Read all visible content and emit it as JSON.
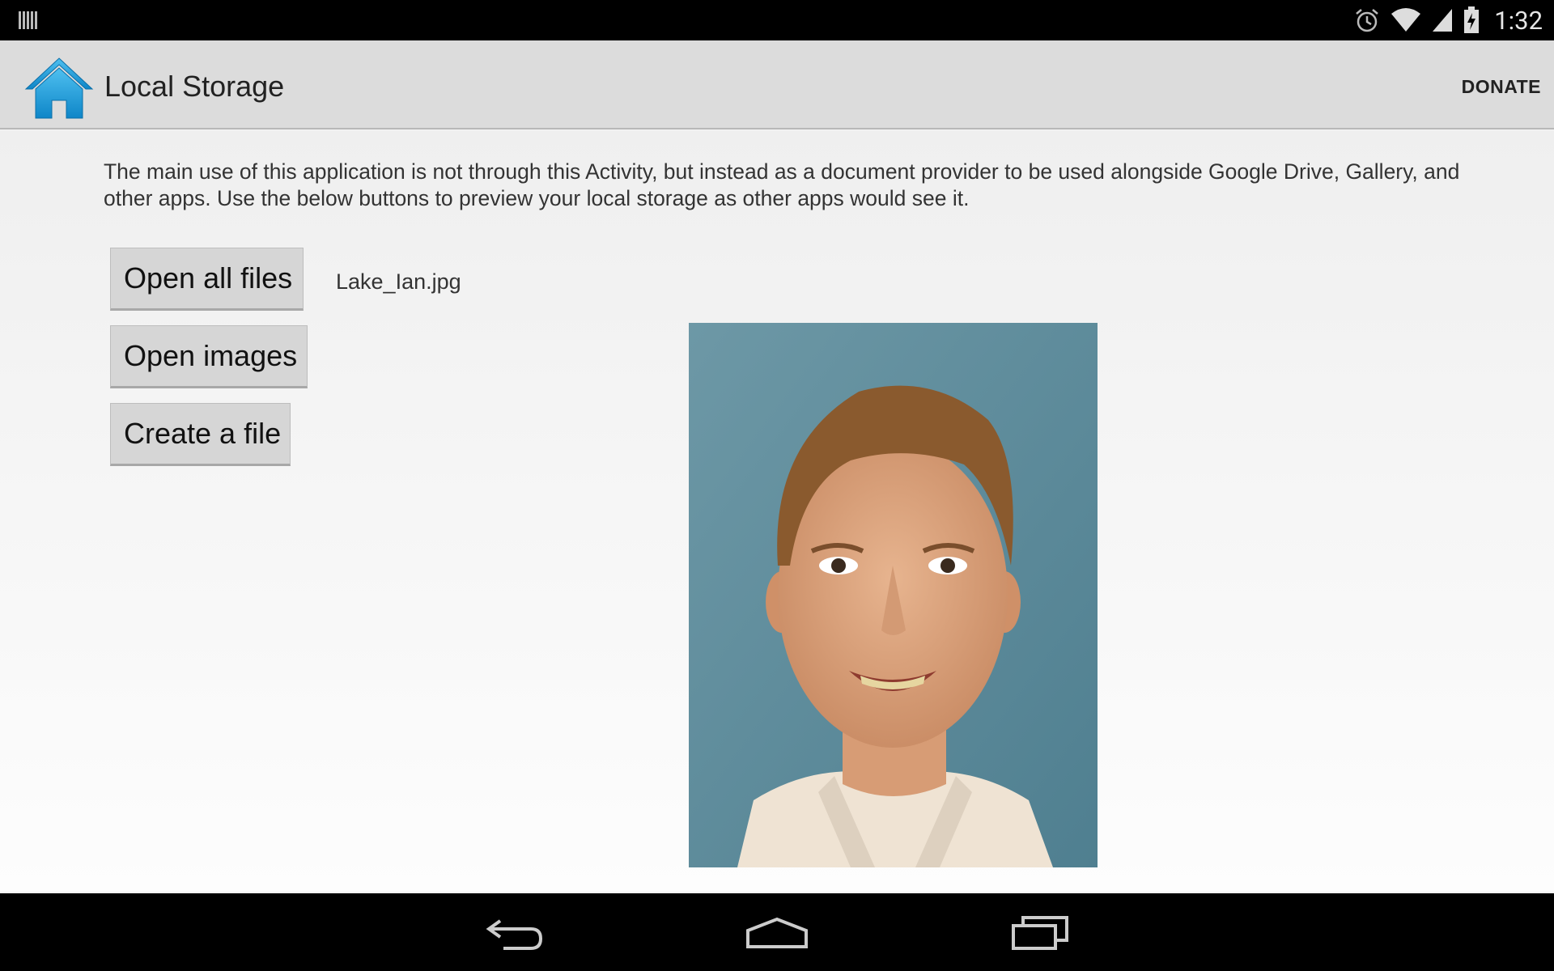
{
  "status_bar": {
    "notification_icon": "barcode-icon",
    "alarm_icon": "alarm-icon",
    "wifi_icon": "wifi-icon",
    "signal_icon": "signal-icon",
    "battery_icon": "battery-charging-icon",
    "time": "1:32"
  },
  "action_bar": {
    "app_icon": "home-icon",
    "title": "Local Storage",
    "donate_label": "DONATE"
  },
  "main": {
    "intro_text": "The main use of this application is not through this Activity, but instead as a document provider to be used alongside Google Drive, Gallery, and other apps. Use the below buttons to preview your local storage as other apps would see it.",
    "buttons": {
      "open_all_files": "Open all files",
      "open_images": "Open images",
      "create_file": "Create a file"
    },
    "selected_file": "Lake_Ian.jpg"
  },
  "nav_bar": {
    "back_icon": "back-icon",
    "home_icon": "home-outline-icon",
    "recents_icon": "recent-apps-icon"
  },
  "colors": {
    "status_bar": "#000000",
    "action_bar": "#dcdcdc",
    "home_icon_blue": "#1e9ad6",
    "button_bg": "#d6d6d6"
  }
}
